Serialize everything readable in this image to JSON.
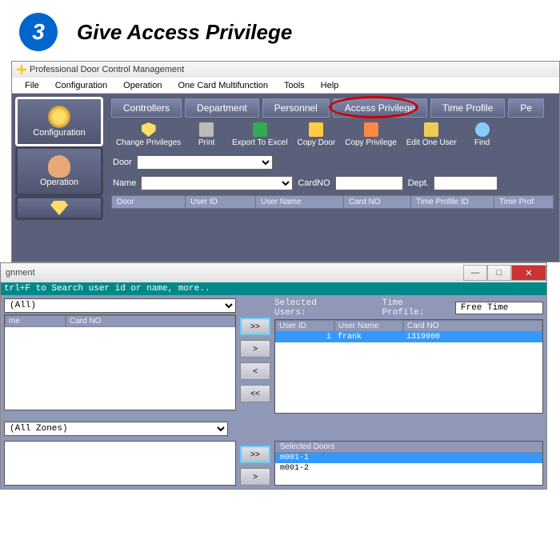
{
  "step": {
    "number": "3",
    "title": "Give Access Privilege"
  },
  "app": {
    "title": "Professional Door Control Management",
    "menu": [
      "File",
      "Configuration",
      "Operation",
      "One Card Multifunction",
      "Tools",
      "Help"
    ],
    "sidebar": [
      {
        "label": "Configuration",
        "active": true
      },
      {
        "label": "Operation",
        "active": false
      },
      {
        "label": "",
        "active": false
      }
    ],
    "tabs": [
      "Controllers",
      "Department",
      "Personnel",
      "Access Privilege",
      "Time Profile",
      "Pe"
    ],
    "highlight_tab_index": 3,
    "toolbar": [
      {
        "label": "Change Privileges"
      },
      {
        "label": "Print"
      },
      {
        "label": "Export To Excel"
      },
      {
        "label": "Copy Door"
      },
      {
        "label": "Copy Privilege"
      },
      {
        "label": "Edit One User"
      },
      {
        "label": "Find"
      }
    ],
    "filters": {
      "door_label": "Door",
      "door_value": "",
      "name_label": "Name",
      "name_value": "",
      "cardno_label": "CardNO",
      "cardno_value": "",
      "dept_label": "Dept.",
      "dept_value": ""
    },
    "grid_cols": [
      "Door",
      "User ID",
      "User Name",
      "Card NO",
      "Time Profile ID",
      "Time Prof"
    ]
  },
  "dialog": {
    "title_fragment": "gnment",
    "hint": "trl+F  to Search user id or name,  more..",
    "dept_combo": "(All)",
    "left_cols": [
      "me",
      "Card NO"
    ],
    "selected_users_label": "Selected Users:",
    "time_profile_label": "Time Profile:",
    "time_profile_value": "Free Time",
    "user_cols": [
      "User ID",
      "User Name",
      "Card NO"
    ],
    "user_row": {
      "id": "1",
      "name": "frank",
      "card": "1319900"
    },
    "move_btns": [
      ">>",
      ">",
      "<",
      "<<"
    ],
    "zone_combo": "(All Zones)",
    "selected_doors_label": "Selected Doors",
    "doors": [
      "m001-1",
      "m001-2"
    ],
    "door_move_btns": [
      ">>",
      ">"
    ]
  }
}
